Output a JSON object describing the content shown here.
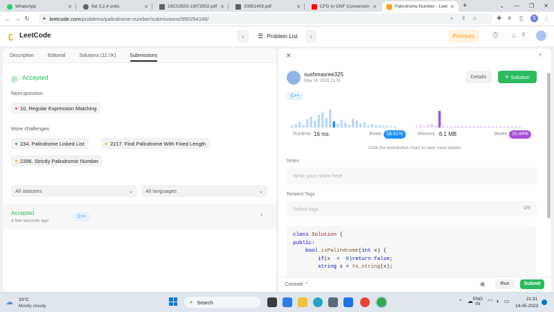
{
  "browser": {
    "tabs": [
      {
        "title": "WhatsApp",
        "color": "#25d366"
      },
      {
        "title": "flat 3,2,4 units",
        "color": "#5f6368"
      },
      {
        "title": "19CS3502-19IT3502.pdf",
        "color": "#5f6368"
      },
      {
        "title": "20851403.pdf",
        "color": "#5f6368"
      },
      {
        "title": "CFG to GNF Conversion (Re",
        "color": "#ff0000"
      },
      {
        "title": "Palindrome Number - Leetc",
        "color": "#ffa116"
      }
    ],
    "new_tab": "+",
    "url_host": "leetcode.com",
    "url_path": "/problems/palindrome-number/submissions/950294166/",
    "profile_initial": "S"
  },
  "header": {
    "logo": "LeetCode",
    "problem_list": "Problem List",
    "premium": "Premium",
    "streak": "0"
  },
  "left": {
    "tabs": [
      "Description",
      "Editorial",
      "Solutions (11.7K)",
      "Submissions"
    ],
    "status": "Accepted",
    "next_question_label": "Next question",
    "next_question": "10. Regular Expression Matching",
    "more_label": "More challenges",
    "challenges": [
      "234. Palindrome Linked List",
      "2217. Find Palindrome With Fixed Length",
      "2396. Strictly Palindromic Number"
    ],
    "filter_status": "All statuses",
    "filter_lang": "All languages",
    "row_status": "Accepted",
    "row_time": "a few seconds ago",
    "row_lang": "C++"
  },
  "right": {
    "username": "sushmasree325",
    "date": "May 14, 2023 21:31",
    "details_btn": "Details",
    "solution_btn": "Solution",
    "lang_badge": "C++",
    "runtime_label": "Runtime",
    "runtime_value": "16 ms",
    "beats_label": "Beats",
    "runtime_beats": "58.51%",
    "memory_label": "Memory",
    "memory_value": "6.1 MB",
    "memory_beats": "15.44%",
    "hint": "Click the distribution chart to view more details",
    "notes_label": "Notes",
    "notes_placeholder": "Write your notes here",
    "tags_label": "Related Tags",
    "tags_placeholder": "Select tags",
    "tags_count": "0/5",
    "code_lines": [
      "class Solution {",
      "public:",
      "    bool isPalindrome(int x) {",
      "        if(x  <  0)return false;",
      "        string s = to_string(x);"
    ],
    "console": "Console",
    "run": "Run",
    "submit": "Submit"
  },
  "taskbar": {
    "temp": "33°C",
    "weather": "Mostly cloudy",
    "search": "Search",
    "lang1": "ENG",
    "lang2": "IN",
    "time": "21:31",
    "date": "14-05-2023"
  },
  "colors": {
    "accepted": "#2cbb5d",
    "accent_blue": "#1a90ff",
    "memory_purple": "#a54fdb",
    "premium": "#ffa116"
  }
}
